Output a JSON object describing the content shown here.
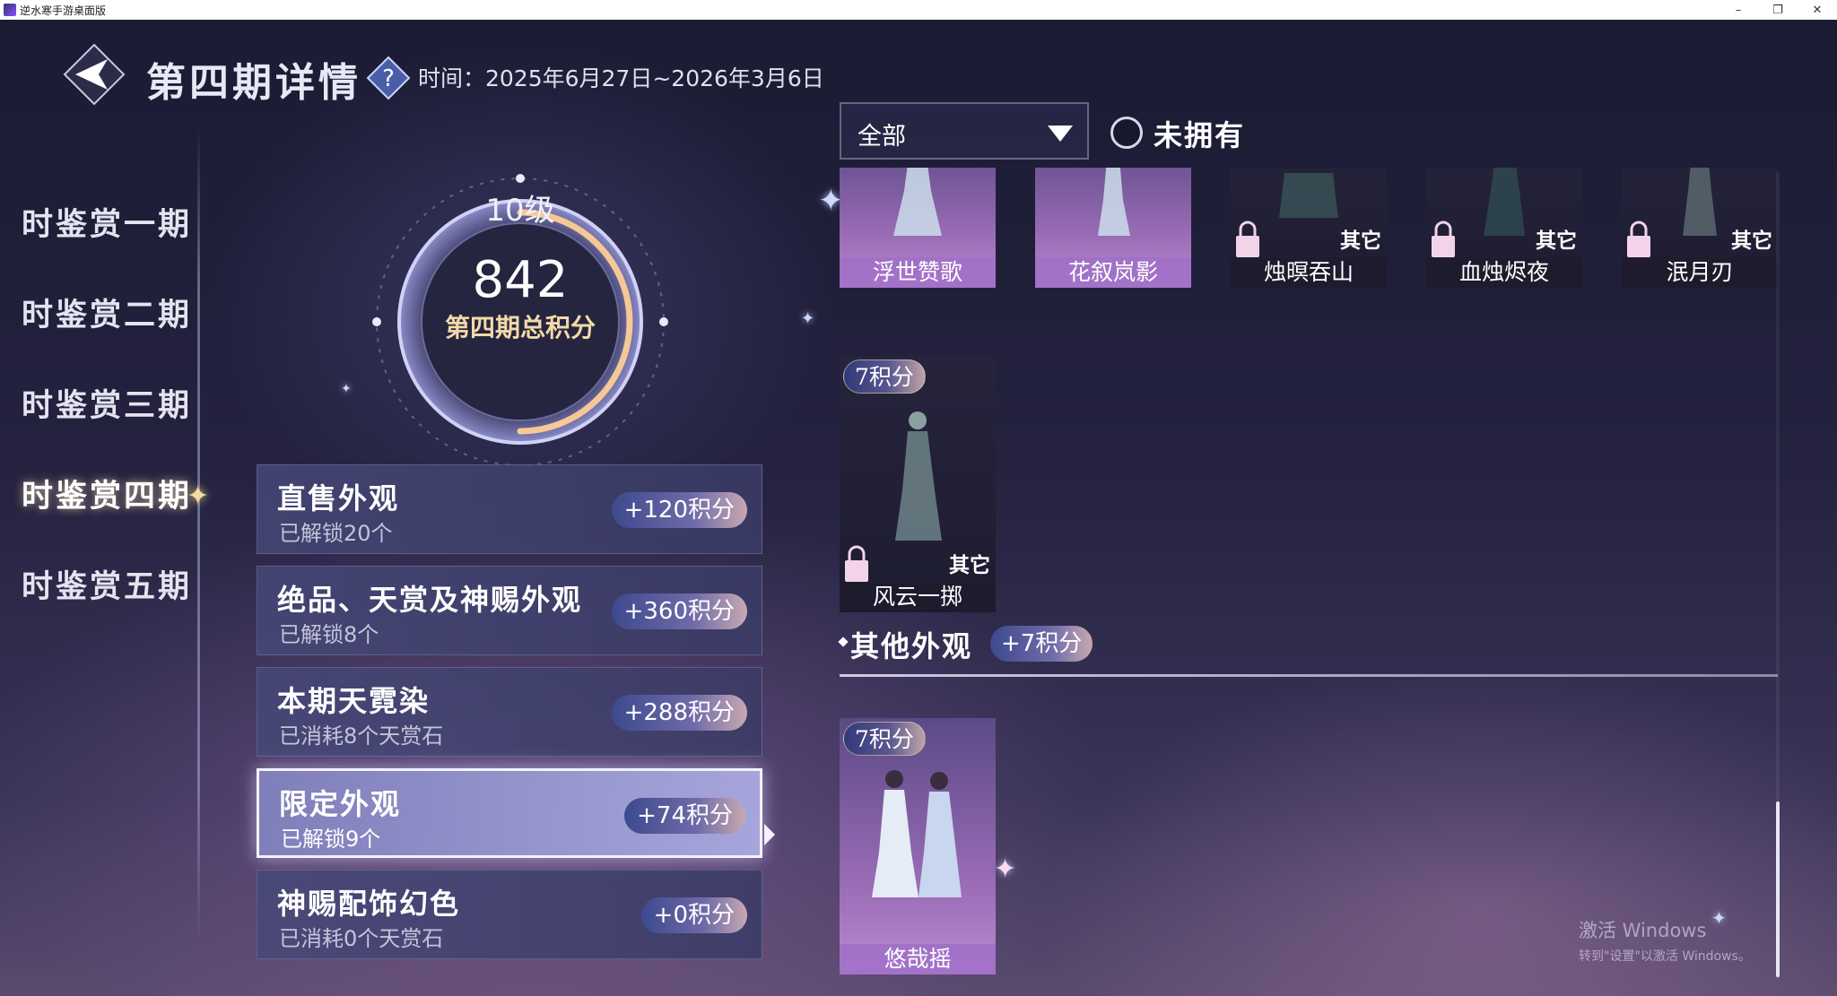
{
  "window": {
    "title": "逆水寒手游桌面版",
    "controls": [
      "–",
      "❐",
      "✕"
    ]
  },
  "header": {
    "title": "第四期详情",
    "time_label": "时间：2025年6月27日~2026年3月6日"
  },
  "nav": {
    "items": [
      {
        "label": "时鉴赏一期",
        "active": false
      },
      {
        "label": "时鉴赏二期",
        "active": false
      },
      {
        "label": "时鉴赏三期",
        "active": false
      },
      {
        "label": "时鉴赏四期",
        "active": true
      },
      {
        "label": "时鉴赏五期",
        "active": false
      }
    ]
  },
  "score": {
    "level": "10级",
    "value": "842",
    "caption": "第四期总积分",
    "ring_progress": 0.5
  },
  "categories": [
    {
      "title": "直售外观",
      "sub": "已解锁20个",
      "points": "+120积分",
      "selected": false
    },
    {
      "title": "绝品、天赏及神赐外观",
      "sub": "已解锁8个",
      "points": "+360积分",
      "selected": false
    },
    {
      "title": "本期天霓染",
      "sub": "已消耗8个天赏石",
      "points": "+288积分",
      "selected": false
    },
    {
      "title": "限定外观",
      "sub": "已解锁9个",
      "points": "+74积分",
      "selected": true
    },
    {
      "title": "神赐配饰幻色",
      "sub": "已消耗0个天赏石",
      "points": "+0积分",
      "selected": false
    }
  ],
  "filter": {
    "value": "全部",
    "not_owned_label": "未拥有",
    "not_owned_checked": false
  },
  "items_top_row": [
    {
      "name": "浮世赞歌",
      "owned": true,
      "tag": ""
    },
    {
      "name": "花叙岚影",
      "owned": true,
      "tag": ""
    },
    {
      "name": "烛暝吞山",
      "owned": false,
      "tag": "其它"
    },
    {
      "name": "血烛烬夜",
      "owned": false,
      "tag": "其它"
    },
    {
      "name": "泯月刃",
      "owned": false,
      "tag": "其它"
    }
  ],
  "item_second_row": {
    "name": "风云一掷",
    "owned": false,
    "tag": "其它",
    "points": "7积分"
  },
  "other_section": {
    "title": "其他外观",
    "points": "+7积分",
    "items": [
      {
        "name": "悠哉摇",
        "owned": true,
        "points": "7积分"
      }
    ]
  },
  "watermark": {
    "title": "激活 Windows",
    "sub": "转到\"设置\"以激活 Windows。"
  },
  "colors": {
    "accent_gold": "#f3d9a8",
    "owned_card": "#9a6cb6",
    "badge_blue": "#3c4a8e"
  }
}
